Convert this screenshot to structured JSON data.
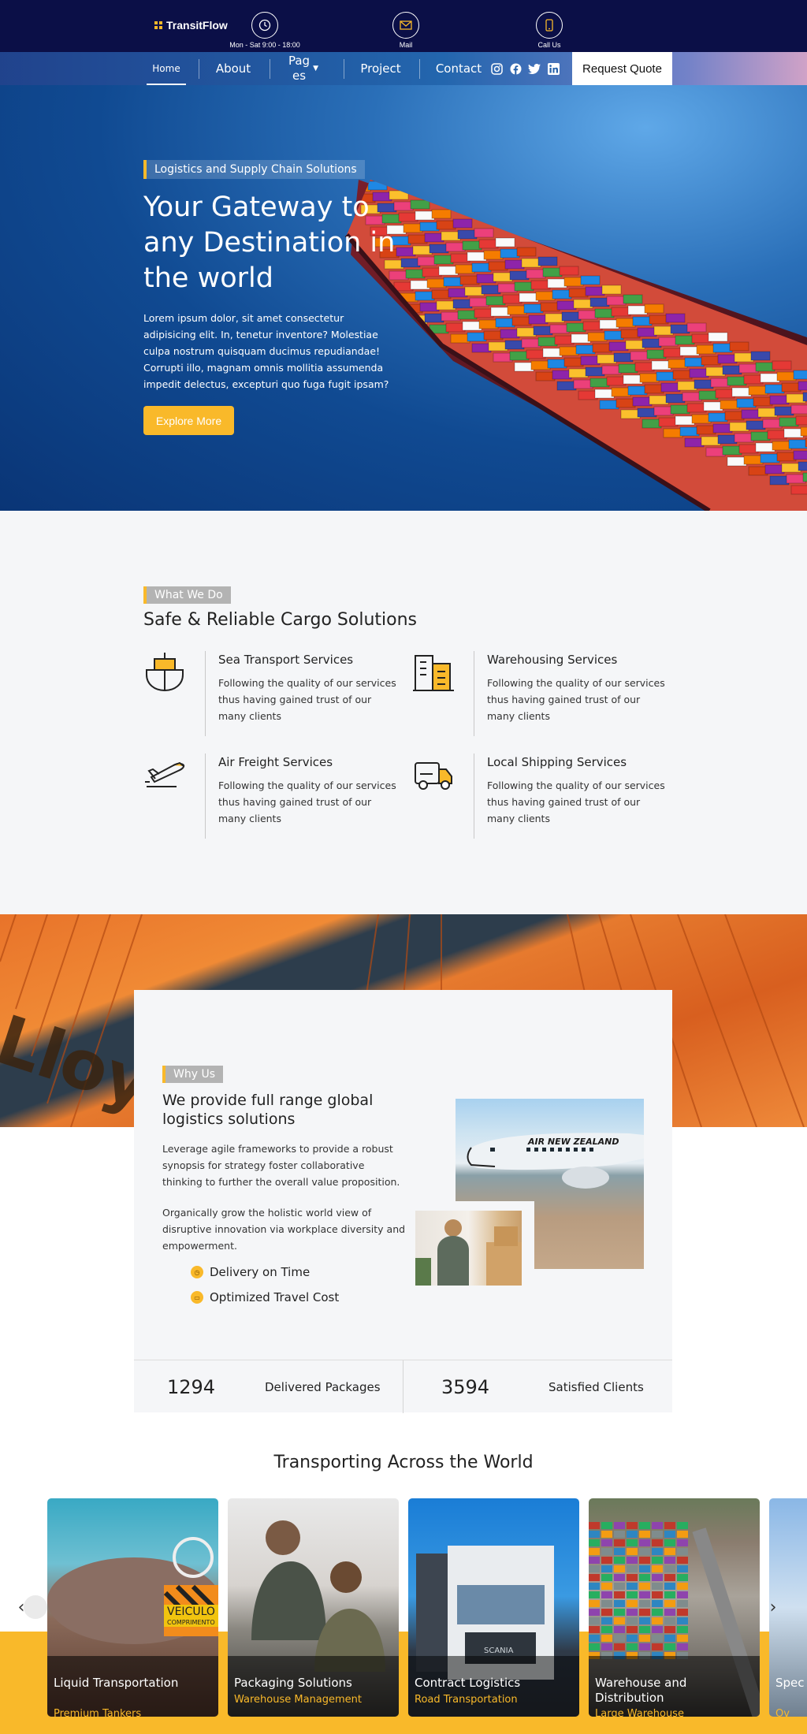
{
  "topbar": {
    "brand": "TransitFlow",
    "hours_label": "Mon - Sat 9:00 - 18:00",
    "mail_label": "Mail",
    "call_label": "Call Us"
  },
  "nav": {
    "items": [
      "Home",
      "About",
      "Pag\nes",
      "Project",
      "Contact"
    ],
    "request_quote": "Request Quote",
    "socials": [
      "instagram-icon",
      "facebook-icon",
      "twitter-icon",
      "linkedin-icon"
    ]
  },
  "hero": {
    "tag": "Logistics and Supply Chain Solutions",
    "title": "Your Gateway to any Destination in the world",
    "text": "Lorem ipsum dolor, sit amet consectetur adipisicing elit. In, tenetur inventore? Molestiae culpa nostrum quisquam ducimus repudiandae! Corrupti illo, magnam omnis mollitia assumenda impedit delectus, excepturi quo fuga fugit ipsam?",
    "button": "Explore More"
  },
  "what_we_do": {
    "tag": "What We Do",
    "title": "Safe & Reliable Cargo Solutions",
    "services": [
      {
        "title": "Sea Transport Services",
        "text": "Following the quality of our services thus having gained trust of our many clients",
        "icon": "ship-icon"
      },
      {
        "title": "Warehousing Services",
        "text": "Following the quality of our services thus having gained trust of our many clients",
        "icon": "warehouse-icon"
      },
      {
        "title": "Air Freight Services",
        "text": "Following the quality of our services thus having gained trust of our many clients",
        "icon": "plane-icon"
      },
      {
        "title": "Local Shipping Services",
        "text": "Following the quality of our services thus having gained trust of our many clients",
        "icon": "truck-icon"
      }
    ]
  },
  "why_us": {
    "tag": "Why Us",
    "title": "We provide full range global logistics solutions",
    "p1": "Leverage agile frameworks to provide a robust synopsis for strategy foster collaborative thinking to further the overall value proposition.",
    "p2": "Organically grow the holistic world view of disruptive innovation via workplace diversity and empowerment.",
    "features": [
      "Delivery on Time",
      "Optimized Travel Cost"
    ],
    "plane_livery": "AIR NEW ZEALAND"
  },
  "stats": [
    {
      "value": "1294",
      "label": "Delivered Packages"
    },
    {
      "value": "3594",
      "label": "Satisfied Clients"
    }
  ],
  "transport": {
    "title": "Transporting Across the World",
    "cards": [
      {
        "title": "Liquid Transportation",
        "sub": "Premium Tankers"
      },
      {
        "title": "Packaging Solutions",
        "sub": "Warehouse Management"
      },
      {
        "title": "Contract Logistics",
        "sub": "Road Transportation"
      },
      {
        "title": "Warehouse and Distribution",
        "sub": "Large Warehouse"
      },
      {
        "title": "Spec Tran",
        "sub": "Ov"
      }
    ],
    "tanker_sign": "VEICULO",
    "tanker_sign2": "COMPRIMENTO",
    "truck_brand": "SCANIA"
  },
  "colors": {
    "navy": "#0b0f47",
    "accent": "#f9b92a",
    "section_bg": "#f5f6f8"
  }
}
